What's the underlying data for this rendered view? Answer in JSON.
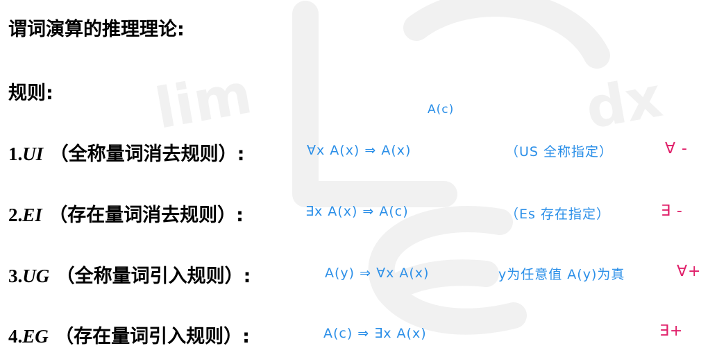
{
  "heading": "谓词演算的推理理论:",
  "subheading": "规则:",
  "rules": [
    {
      "number": "1.",
      "abbr": "UI",
      "title": "（全称量词消去规则）:",
      "formula": "∀x A(x) ⇒ A(x)",
      "above_note": "A(c)",
      "note": "（US 全称指定）",
      "tag": "∀ -"
    },
    {
      "number": "2.",
      "abbr": "EI",
      "title": "（存在量词消去规则）:",
      "formula": "∃x A(x) ⇒ A(c)",
      "note": "（Es 存在指定）",
      "tag": "∃ -"
    },
    {
      "number": "3.",
      "abbr": "UG",
      "title": "（全称量词引入规则）:",
      "formula": "A(y) ⇒ ∀x A(x)",
      "note": "y为任意值 A(y)为真",
      "tag": "∀+"
    },
    {
      "number": "4.",
      "abbr": "EG",
      "title": "（存在量词引入规则）:",
      "formula": "A(c) ⇒ ∃x A(x)",
      "tag": "∃+"
    }
  ],
  "colors": {
    "text": "#000000",
    "handwriting_blue": "#2b8fe8",
    "handwriting_pink": "#e0206a",
    "watermark": "#f0f0f0"
  }
}
